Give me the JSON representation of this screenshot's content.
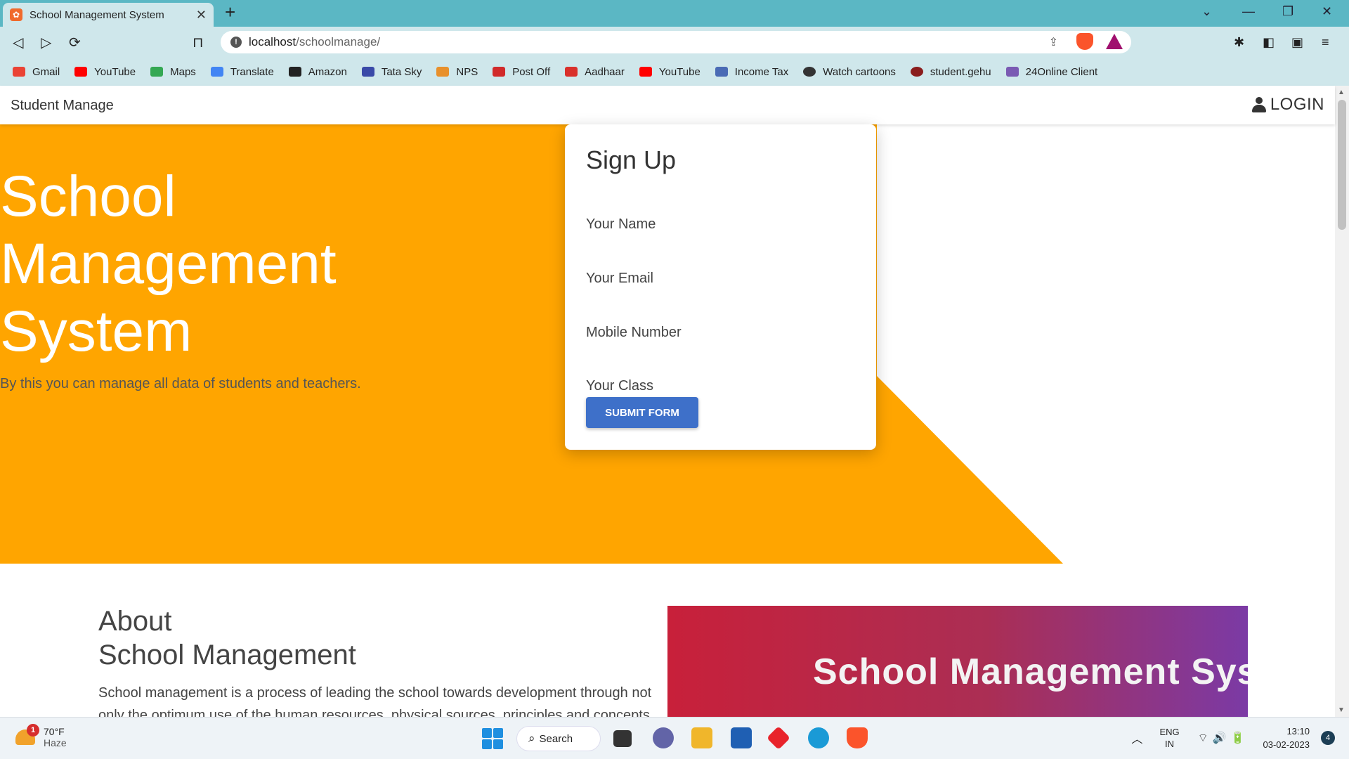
{
  "browser": {
    "tab_title": "School Management System",
    "tab_close": "✕",
    "new_tab": "+",
    "url_host": "localhost",
    "url_path": "/schoolmanage/",
    "window_controls": [
      "⌄",
      "—",
      "❐",
      "✕"
    ],
    "nav": [
      "◁",
      "▷",
      "⟳"
    ],
    "bookmarks": [
      {
        "label": "Gmail",
        "color": "#ea4335"
      },
      {
        "label": "YouTube",
        "color": "#ff0000"
      },
      {
        "label": "Maps",
        "color": "#34a853"
      },
      {
        "label": "Translate",
        "color": "#4285f4"
      },
      {
        "label": "Amazon",
        "color": "#222222"
      },
      {
        "label": "Tata Sky",
        "color": "#3a4aa8"
      },
      {
        "label": "NPS",
        "color": "#e8902b"
      },
      {
        "label": "Post Off",
        "color": "#d12a2a"
      },
      {
        "label": "Aadhaar",
        "color": "#d9302b"
      },
      {
        "label": "YouTube",
        "color": "#ff0000"
      },
      {
        "label": "Income Tax",
        "color": "#4a6bb5"
      },
      {
        "label": "Watch cartoons",
        "color": "#333333"
      },
      {
        "label": "student.gehu",
        "color": "#8a1d1d"
      },
      {
        "label": "24Online Client",
        "color": "#7a5ab3"
      }
    ]
  },
  "navbar": {
    "brand": "Student Manage",
    "login_label": "LOGIN"
  },
  "hero": {
    "title_lines": [
      "School",
      "Management",
      "System"
    ],
    "subtitle": "By this you can manage all data of students and teachers.",
    "bg_color": "#ffa500"
  },
  "signup": {
    "heading": "Sign Up",
    "name_placeholder": "Your Name",
    "email_placeholder": "Your Email",
    "mobile_placeholder": "Mobile Number",
    "class_placeholder": "Your Class",
    "submit_label": "SUBMIT FORM"
  },
  "about": {
    "heading_line1": "About",
    "heading_line2": "School Management",
    "text": "School management is a process of leading the school towards development through not only the optimum use of the human resources, physical sources, principles and concepts",
    "banner_text": "School Management Syste"
  },
  "taskbar": {
    "weather_temp": "70°F",
    "weather_desc": "Haze",
    "weather_badge": "1",
    "search_label": "Search",
    "lang_line1": "ENG",
    "lang_line2": "IN",
    "time": "13:10",
    "date": "03-02-2023",
    "notification_count": "4"
  }
}
